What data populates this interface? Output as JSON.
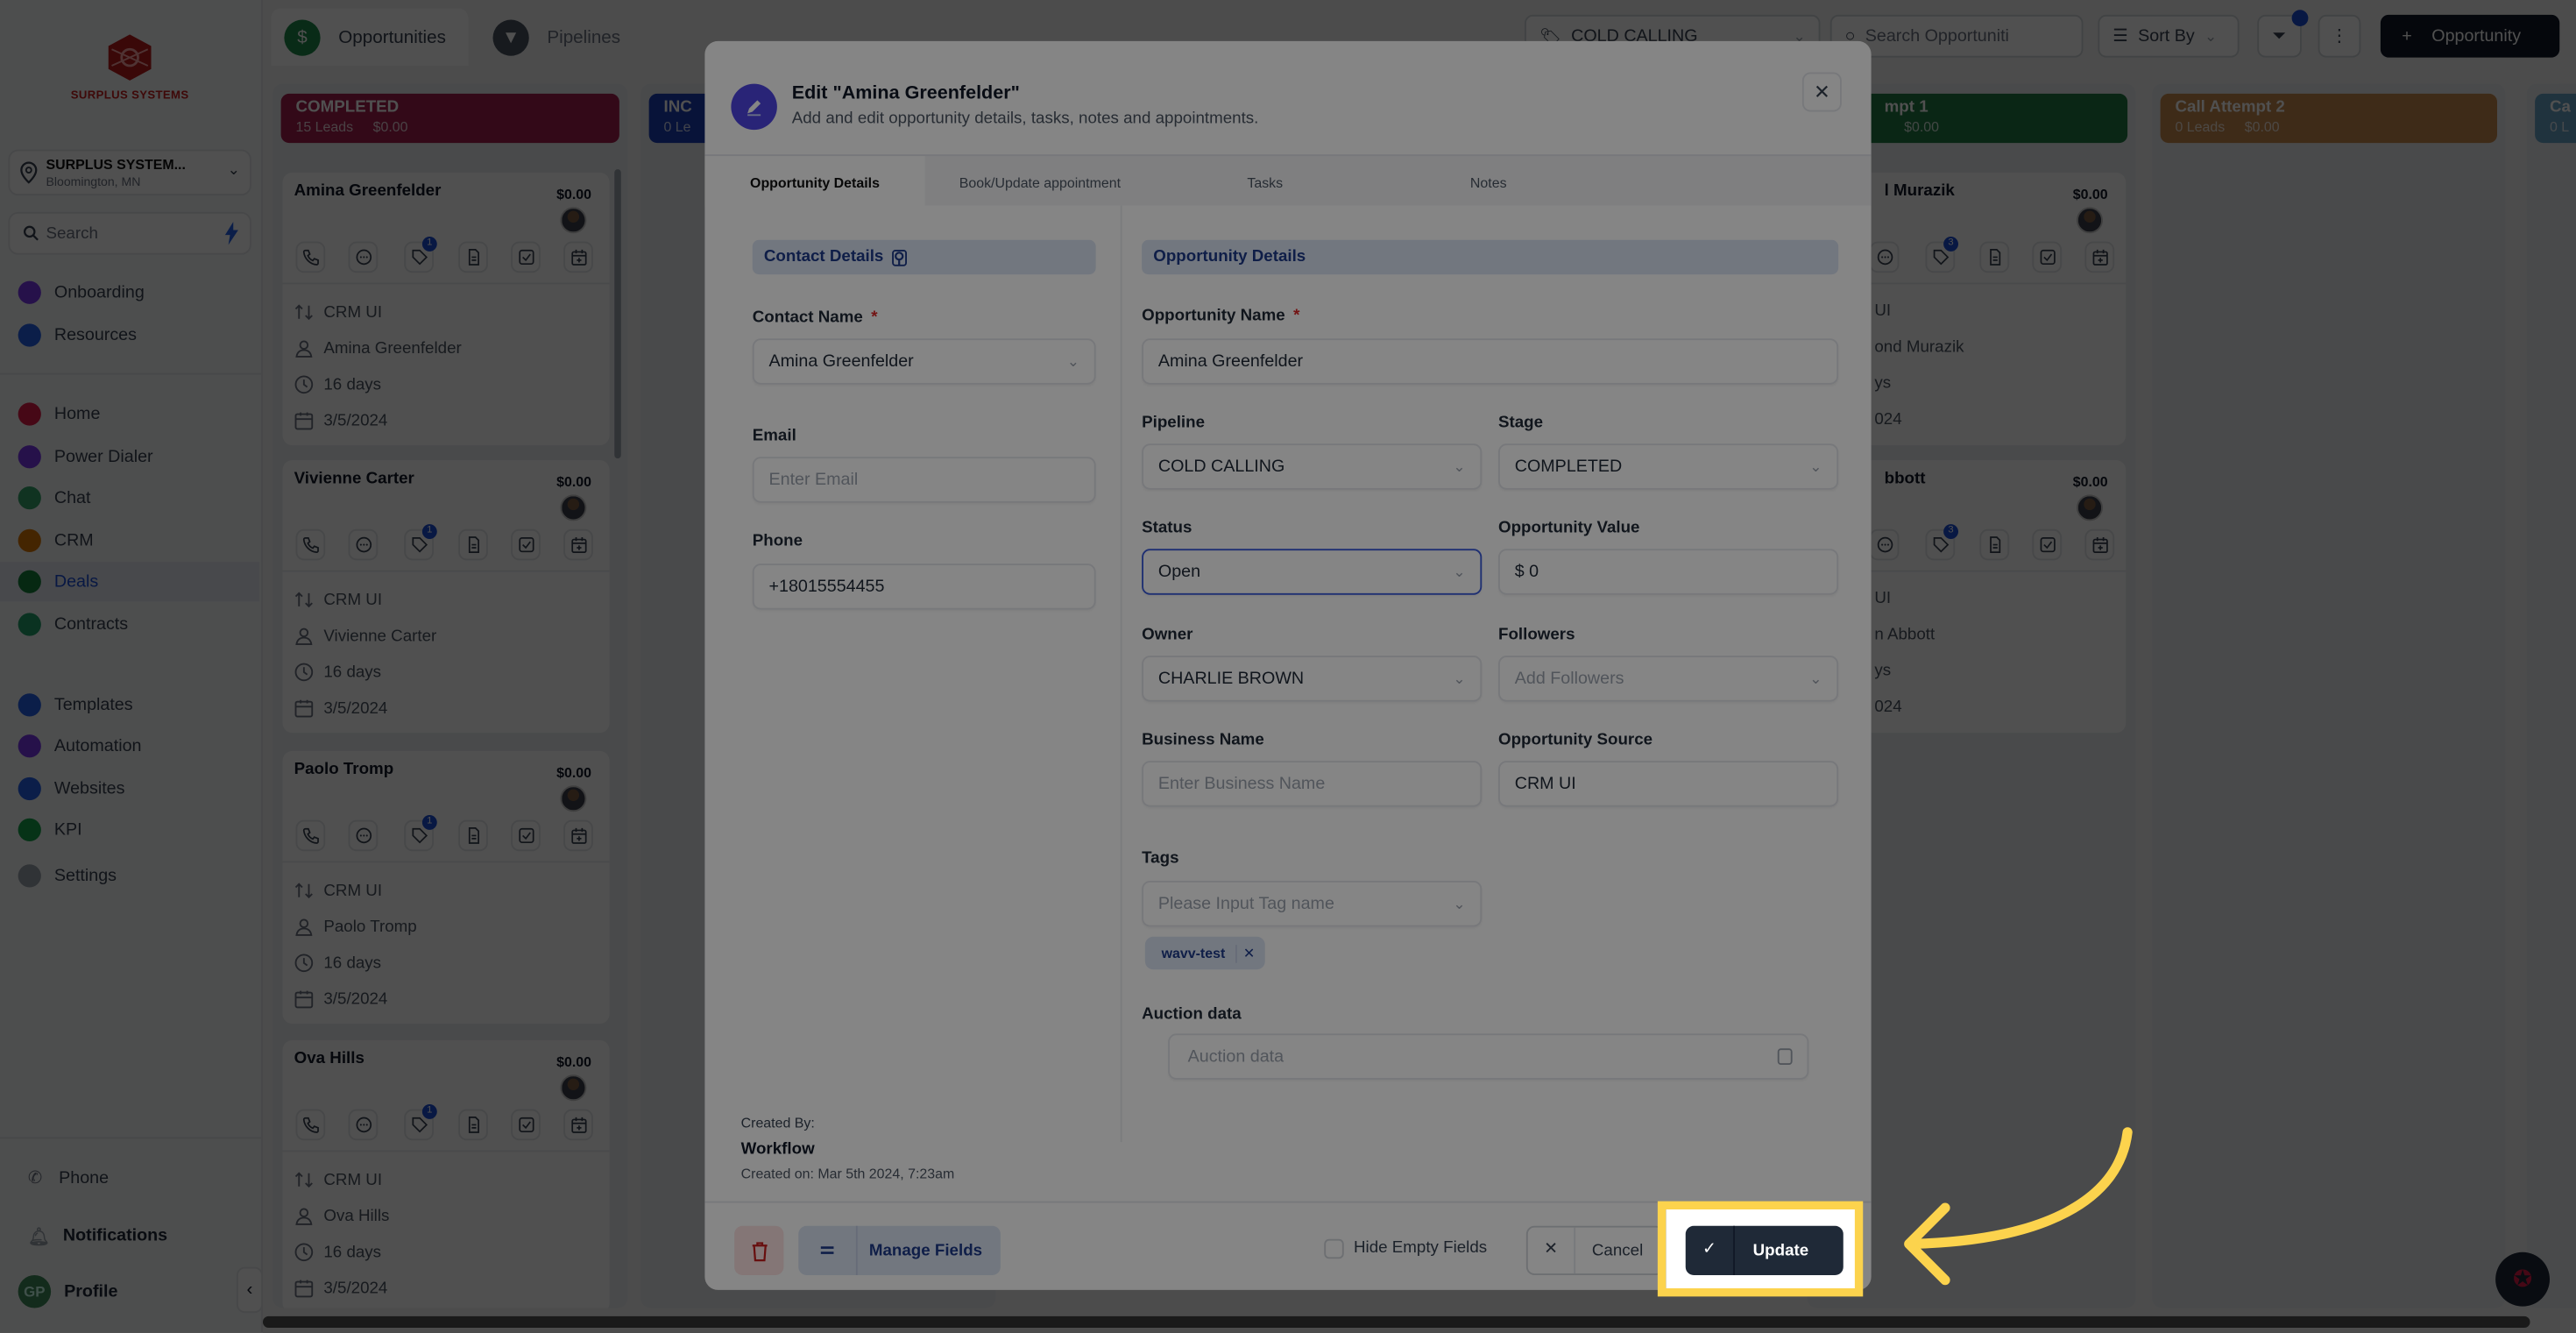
{
  "sidebar": {
    "logo_text": "SURPLUS SYSTEMS",
    "location": {
      "name": "SURPLUS SYSTEM...",
      "city": "Bloomington, MN"
    },
    "search_label": "Search",
    "groups": [
      [
        {
          "label": "Onboarding",
          "color": "#7c3aed"
        },
        {
          "label": "Resources",
          "color": "#2563eb"
        }
      ],
      [
        {
          "label": "Home",
          "color": "#e11d48"
        },
        {
          "label": "Power Dialer",
          "color": "#7c3aed"
        },
        {
          "label": "Chat",
          "color": "#34a36b"
        },
        {
          "label": "CRM",
          "color": "#d97706"
        },
        {
          "label": "Deals",
          "color": "#15803d",
          "active": true
        },
        {
          "label": "Contracts",
          "color": "#22a06b"
        }
      ],
      [
        {
          "label": "Templates",
          "color": "#2563eb"
        },
        {
          "label": "Automation",
          "color": "#7c3aed"
        },
        {
          "label": "Websites",
          "color": "#2563eb"
        },
        {
          "label": "KPI",
          "color": "#16a34a"
        },
        {
          "label": "Settings",
          "color": "#9ca3af"
        }
      ]
    ],
    "bottom": {
      "phone": "Phone",
      "notifications": "Notifications",
      "profile": "Profile",
      "profile_initials": "GP"
    }
  },
  "topbar": {
    "tabs": [
      {
        "label": "Opportunities",
        "icon": "dollar-icon"
      },
      {
        "label": "Pipelines",
        "icon": "funnel-icon"
      }
    ],
    "pipeline_select": "COLD CALLING",
    "search_placeholder": "Search Opportuniti",
    "sort_label": "Sort By",
    "add_label": "Opportunity"
  },
  "board": {
    "lanes": [
      {
        "name": "COMPLETED",
        "leads": "15 Leads",
        "value": "$0.00",
        "color": "#a3214f",
        "cards": [
          {
            "title": "Amina Greenfelder",
            "value": "$0.00",
            "badge": "1",
            "source": "CRM UI",
            "contact": "Amina Greenfelder",
            "age": "16 days",
            "date": "3/5/2024"
          },
          {
            "title": "Vivienne Carter",
            "value": "$0.00",
            "badge": "1",
            "source": "CRM UI",
            "contact": "Vivienne Carter",
            "age": "16 days",
            "date": "3/5/2024"
          },
          {
            "title": "Paolo Tromp",
            "value": "$0.00",
            "badge": "1",
            "source": "CRM UI",
            "contact": "Paolo Tromp",
            "age": "16 days",
            "date": "3/5/2024"
          },
          {
            "title": "Ova Hills",
            "value": "$0.00",
            "badge": "1",
            "source": "CRM UI",
            "contact": "Ova Hills",
            "age": "16 days",
            "date": "3/5/2024"
          }
        ]
      },
      {
        "name": "INC",
        "leads": "0 Le",
        "value": "",
        "color": "#1d3fb8",
        "cards": []
      },
      {
        "name": "mpt 1",
        "leads": "",
        "value": "$0.00",
        "color": "#237a45",
        "cards": [
          {
            "title": "l Murazik",
            "value": "$0.00",
            "badge": "3",
            "source": "UI",
            "contact": "ond Murazik",
            "age": "ys",
            "date": "024"
          },
          {
            "title": "bbott",
            "value": "$0.00",
            "badge": "3",
            "source": "UI",
            "contact": "n Abbott",
            "age": "ys",
            "date": "024"
          }
        ]
      },
      {
        "name": "Call Attempt 2",
        "leads": "0 Leads",
        "value": "$0.00",
        "color": "#c98a4f",
        "cards": []
      },
      {
        "name": "Ca",
        "leads": "0 L",
        "value": "",
        "color": "#6aa3c8",
        "cards": []
      }
    ]
  },
  "modal": {
    "title": "Edit \"Amina Greenfelder\"",
    "subtitle": "Add and edit opportunity details, tasks, notes and appointments.",
    "tabs": [
      "Opportunity Details",
      "Book/Update appointment",
      "Tasks",
      "Notes"
    ],
    "active_tab": "Opportunity Details",
    "contact": {
      "header": "Contact Details",
      "name_label": "Contact Name",
      "name_value": "Amina Greenfelder",
      "email_label": "Email",
      "email_placeholder": "Enter Email",
      "phone_label": "Phone",
      "phone_value": "+18015554455"
    },
    "opportunity": {
      "header": "Opportunity Details",
      "name_label": "Opportunity Name",
      "name_value": "Amina Greenfelder",
      "pipeline_label": "Pipeline",
      "pipeline_value": "COLD CALLING",
      "stage_label": "Stage",
      "stage_value": "COMPLETED",
      "status_label": "Status",
      "status_value": "Open",
      "value_label": "Opportunity Value",
      "value_value": "$ 0",
      "owner_label": "Owner",
      "owner_value": "CHARLIE BROWN",
      "followers_label": "Followers",
      "followers_placeholder": "Add Followers",
      "business_label": "Business Name",
      "business_placeholder": "Enter Business Name",
      "source_label": "Opportunity Source",
      "source_value": "CRM UI",
      "tags_label": "Tags",
      "tags_placeholder": "Please Input Tag name",
      "tags": [
        "wavv-test"
      ],
      "auction_label": "Auction data",
      "auction_placeholder": "Auction data"
    },
    "created": {
      "label": "Created By:",
      "by": "Workflow",
      "on": "Created on: Mar 5th 2024, 7:23am"
    },
    "footer": {
      "manage_fields": "Manage Fields",
      "hide_empty": "Hide Empty Fields",
      "hide_empty_checked": false,
      "cancel": "Cancel",
      "update": "Update"
    }
  },
  "highlight": {
    "color": "#fcd34d",
    "target": "Update"
  }
}
